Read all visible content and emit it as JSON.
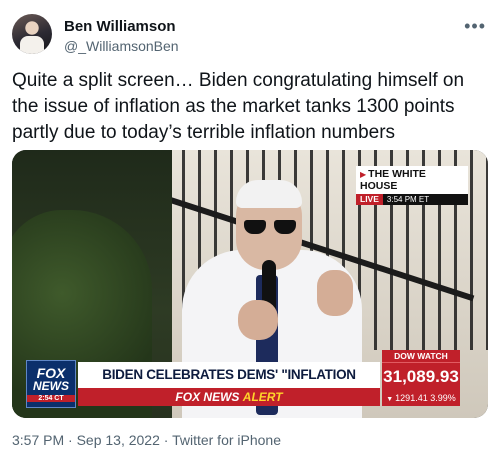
{
  "author": {
    "name": "Ben Williamson",
    "handle": "@_WilliamsonBen",
    "more_icon": "ellipsis-icon"
  },
  "tweet": {
    "text": "Quite a split screen… Biden congratulating himself on the issue of inflation as the market tanks 1300 points partly due to today’s terrible inflation numbers"
  },
  "media": {
    "location_tag": "THE WHITE HOUSE",
    "live_label": "LIVE",
    "live_time": "3:54 PM ET",
    "network_logo_line1": "FOX",
    "network_logo_line2": "NEWS",
    "network_time": "2:54 CT",
    "headline": "BIDEN CELEBRATES DEMS' \"INFLATION REDUCTION ACT\"",
    "alert_network": "FOX NEWS",
    "alert_word": "ALERT",
    "dow_label": "DOW WATCH",
    "dow_value": "31,089.93",
    "dow_change": "1291.41",
    "dow_change_pct": "3.99%",
    "colors": {
      "fox_red": "#c0202a",
      "fox_blue": "#0b2f6b",
      "alert_yellow": "#ffd42a"
    }
  },
  "footer": {
    "timestamp": "3:57 PM · Sep 13, 2022 · Twitter for iPhone"
  }
}
